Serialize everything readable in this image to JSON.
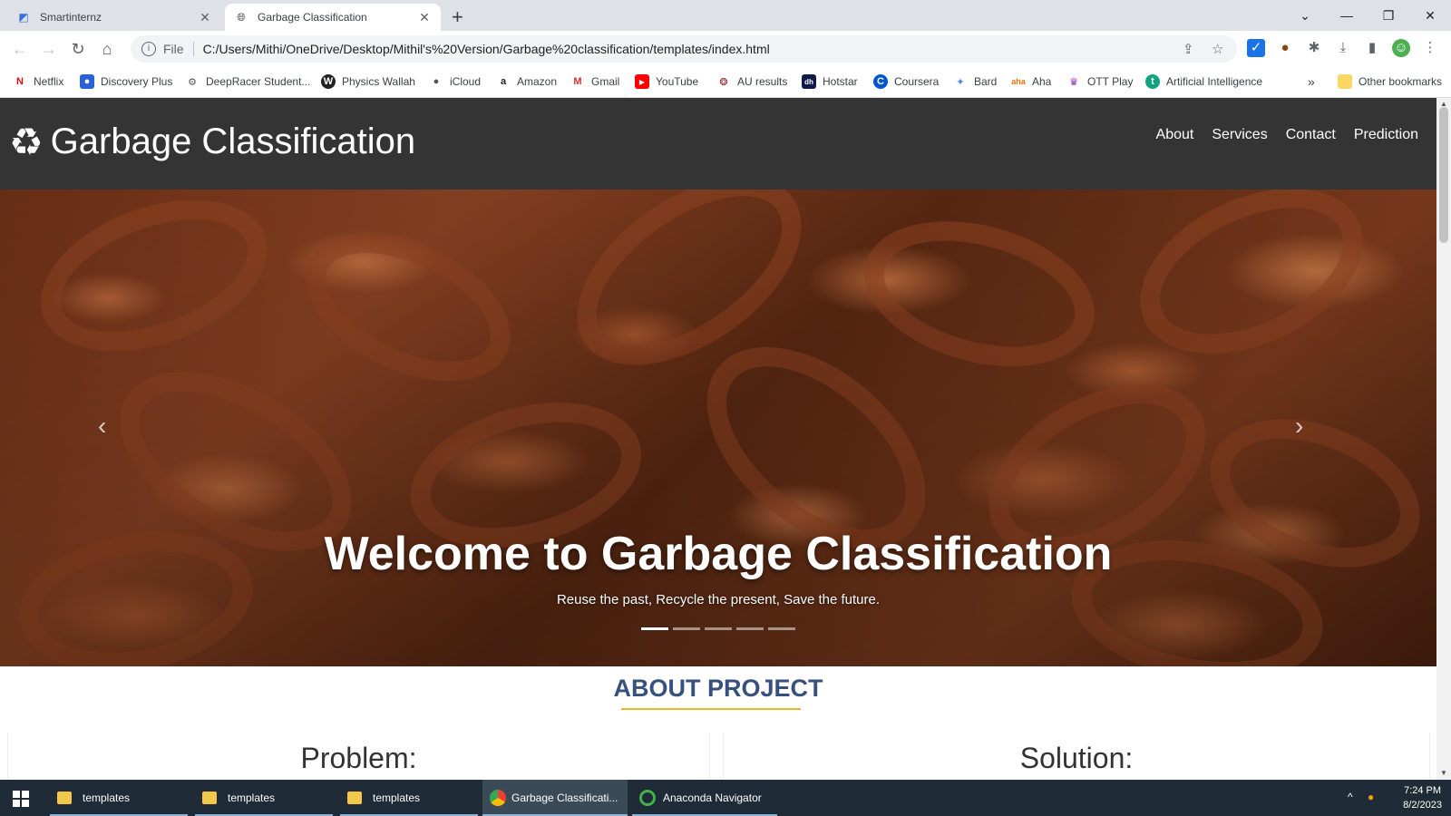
{
  "browser": {
    "tabs": [
      {
        "title": "Smartinternz",
        "active": false
      },
      {
        "title": "Garbage Classification",
        "active": true
      }
    ],
    "url_scheme": "File",
    "url": "C:/Users/Mithi/OneDrive/Desktop/Mithil's%20Version/Garbage%20classification/templates/index.html",
    "bookmarks": [
      {
        "label": "Netflix",
        "icon": "netflix-icon",
        "color": "#e50914"
      },
      {
        "label": "Discovery Plus",
        "icon": "discovery-plus-icon",
        "color": "#2a62d6"
      },
      {
        "label": "DeepRacer Student...",
        "icon": "deepracer-icon",
        "color": "#555555"
      },
      {
        "label": "Physics Wallah",
        "icon": "physics-wallah-icon",
        "color": "#222222"
      },
      {
        "label": "iCloud",
        "icon": "apple-icon",
        "color": "#555555"
      },
      {
        "label": "Amazon",
        "icon": "amazon-icon",
        "color": "#222222"
      },
      {
        "label": "Gmail",
        "icon": "gmail-icon",
        "color": "#d93025"
      },
      {
        "label": "YouTube",
        "icon": "youtube-icon",
        "color": "#ff0000"
      },
      {
        "label": "AU results",
        "icon": "au-results-icon",
        "color": "#8b1a1a"
      },
      {
        "label": "Hotstar",
        "icon": "hotstar-icon",
        "color": "#0f1a4a"
      },
      {
        "label": "Coursera",
        "icon": "coursera-icon",
        "color": "#0056d2"
      },
      {
        "label": "Bard",
        "icon": "bard-icon",
        "color": "#4285f4"
      },
      {
        "label": "Aha",
        "icon": "aha-icon",
        "color": "#ff6d00"
      },
      {
        "label": "OTT Play",
        "icon": "ott-play-icon",
        "color": "#8e24aa"
      },
      {
        "label": "Artificial Intelligence",
        "icon": "ai-icon",
        "color": "#10a37f"
      }
    ],
    "other_bookmarks": "Other bookmarks",
    "more_bookmarks": "»"
  },
  "site": {
    "brand": "Garbage Classification",
    "nav": [
      "About",
      "Services",
      "Contact",
      "Prediction"
    ],
    "hero": {
      "title": "Welcome to Garbage Classification",
      "subtitle": "Reuse the past, Recycle the present, Save the future.",
      "slide_count": 5,
      "active_slide": 1
    },
    "about": {
      "title": "ABOUT PROJECT",
      "columns": [
        "Problem:",
        "Solution:"
      ]
    },
    "colors": {
      "navbar": "#343434",
      "heading": "#37517e",
      "accent": "#f0b429"
    }
  },
  "taskbar": {
    "items": [
      {
        "label": "templates",
        "icon": "folder-icon"
      },
      {
        "label": "templates",
        "icon": "folder-icon"
      },
      {
        "label": "templates",
        "icon": "folder-icon"
      },
      {
        "label": "Garbage Classificati...",
        "icon": "chrome-icon"
      },
      {
        "label": "Anaconda Navigator",
        "icon": "anaconda-icon"
      }
    ],
    "time": "7:24 PM",
    "date": "8/2/2023"
  }
}
